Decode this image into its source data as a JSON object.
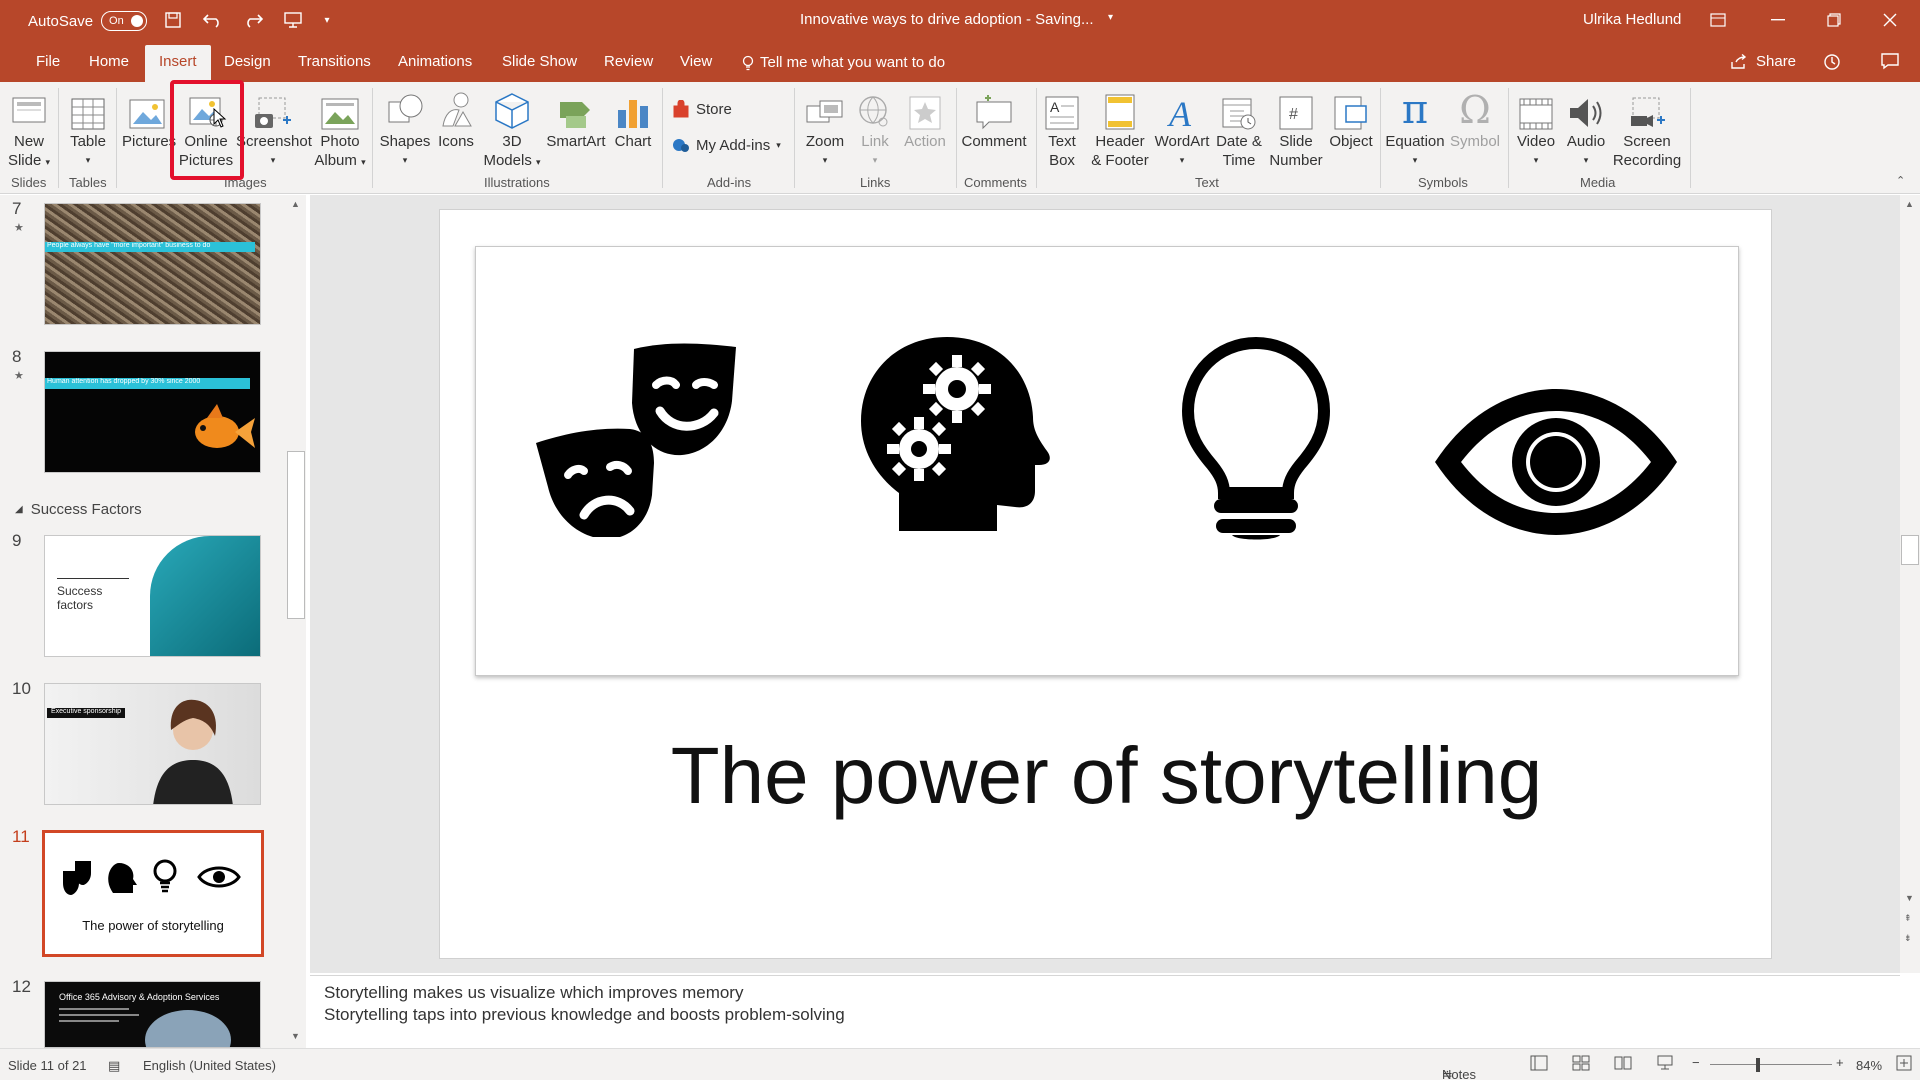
{
  "titlebar": {
    "autosave_label": "AutoSave",
    "autosave_state": "On",
    "document_title": "Innovative ways to drive adoption  -  Saving...",
    "user_name": "Ulrika Hedlund"
  },
  "tabs": [
    "File",
    "Home",
    "Insert",
    "Design",
    "Transitions",
    "Animations",
    "Slide Show",
    "Review",
    "View"
  ],
  "active_tab": "Insert",
  "tell_me": "Tell me what you want to do",
  "share_label": "Share",
  "ribbon": {
    "new_slide": [
      "New",
      "Slide"
    ],
    "table": "Table",
    "pictures": "Pictures",
    "online_pictures": [
      "Online",
      "Pictures"
    ],
    "screenshot": "Screenshot",
    "photo_album": [
      "Photo",
      "Album"
    ],
    "shapes": "Shapes",
    "icons": "Icons",
    "models_3d": [
      "3D",
      "Models"
    ],
    "smartart": "SmartArt",
    "chart": "Chart",
    "store": "Store",
    "my_addins": "My Add-ins",
    "zoom": "Zoom",
    "link": "Link",
    "action": "Action",
    "comment": "Comment",
    "text_box": [
      "Text",
      "Box"
    ],
    "header_footer": [
      "Header",
      "& Footer"
    ],
    "wordart": "WordArt",
    "date_time": [
      "Date &",
      "Time"
    ],
    "slide_number": [
      "Slide",
      "Number"
    ],
    "object": "Object",
    "equation": "Equation",
    "symbol": "Symbol",
    "video": "Video",
    "audio": "Audio",
    "screen_recording": [
      "Screen",
      "Recording"
    ],
    "groups": {
      "slides": "Slides",
      "tables": "Tables",
      "images": "Images",
      "illustrations": "Illustrations",
      "addins": "Add-ins",
      "links": "Links",
      "comments": "Comments",
      "text": "Text",
      "symbols": "Symbols",
      "media": "Media"
    }
  },
  "thumbnails": {
    "slide7": {
      "number": "7",
      "caption": "People always have \"more important\" business to do"
    },
    "slide8": {
      "number": "8",
      "caption": "Human attention has dropped by 30% since 2000"
    },
    "section": "Success Factors",
    "slide9": {
      "number": "9",
      "title": "Success factors"
    },
    "slide10": {
      "number": "10",
      "caption": "Executive sponsorship"
    },
    "slide11": {
      "number": "11",
      "title": "The power of storytelling"
    },
    "slide12": {
      "number": "12",
      "title": "Office 365 Advisory & Adoption Services"
    }
  },
  "slide": {
    "title": "The power of storytelling",
    "icons": [
      "theater-masks-icon",
      "head-gears-icon",
      "lightbulb-icon",
      "eye-icon"
    ]
  },
  "notes": [
    "Storytelling makes us visualize which improves memory",
    "Storytelling taps into previous knowledge and boosts problem-solving"
  ],
  "status": {
    "slide_info": "Slide 11 of 21",
    "language": "English (United States)",
    "notes_label": "Notes",
    "zoom": "84%"
  },
  "colors": {
    "accent": "#b7472a",
    "selection": "#d24726",
    "highlight": "#e3102c"
  }
}
